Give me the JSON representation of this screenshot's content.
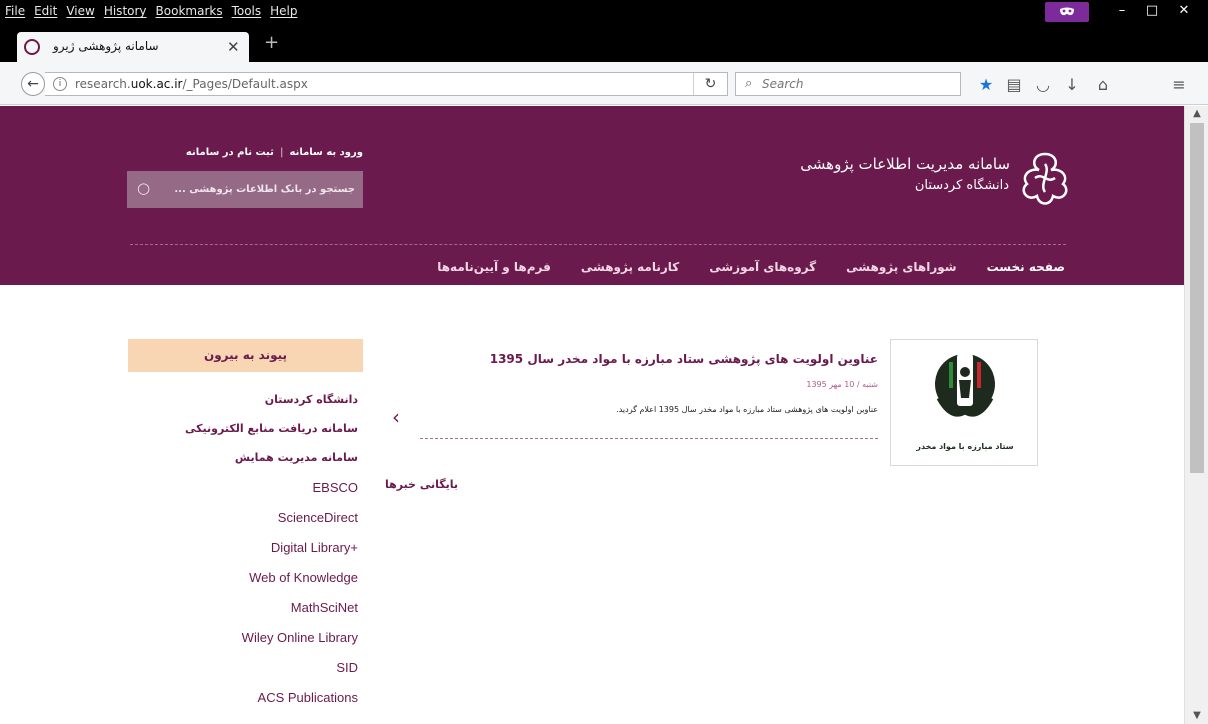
{
  "browser": {
    "menu": [
      "File",
      "Edit",
      "View",
      "History",
      "Bookmarks",
      "Tools",
      "Help"
    ],
    "tab_title": "سامانه پژوهشی ژیرو",
    "url_prefix": "research.",
    "url_domain": "uok.ac.ir",
    "url_path": "/_Pages/Default.aspx",
    "search_placeholder": "Search"
  },
  "header": {
    "title": "سامانه مدیریت اطلاعات پژوهشی",
    "subtitle": "دانشگاه کردستان",
    "login": "ورود به سامانه",
    "register": "ثبت نام در سامانه",
    "search_placeholder": "جستجو در بانک اطلاعات پژوهشی ..."
  },
  "nav": [
    {
      "label": "صفحه نخست"
    },
    {
      "label": "شوراهای پژوهشی"
    },
    {
      "label": "گروه‌های آموزشی"
    },
    {
      "label": "کارنامه پژوهشی"
    },
    {
      "label": "فرم‌ها و آیین‌نامه‌ها"
    }
  ],
  "sidebar": {
    "heading": "پیوند به بیرون",
    "links_fa": [
      "دانشگاه کردستان",
      "سامانه دریافت منابع الکترونیکی",
      "سامانه مدیریت همایش"
    ],
    "links_en": [
      "EBSCO",
      "ScienceDirect",
      "Digital Library+",
      "Web of Knowledge",
      "MathSciNet",
      "Wiley Online Library",
      "SID",
      "ACS Publications"
    ]
  },
  "news": {
    "title": "عناوین اولویت های پژوهشی ستاد مبارزه با مواد مخدر سال 1395",
    "date": "شنبه / 10 مهر 1395",
    "summary": "عناوین اولویت های پژوهشی ستاد مبارزه با مواد مخدر سال 1395 اعلام گردید.",
    "image_caption": "ستاد مبارزه با مواد مخدر",
    "archive": "بایگانی خبرها"
  },
  "colors": {
    "brand": "#6b1a4d",
    "sidebar_head": "#f8d6b3"
  }
}
